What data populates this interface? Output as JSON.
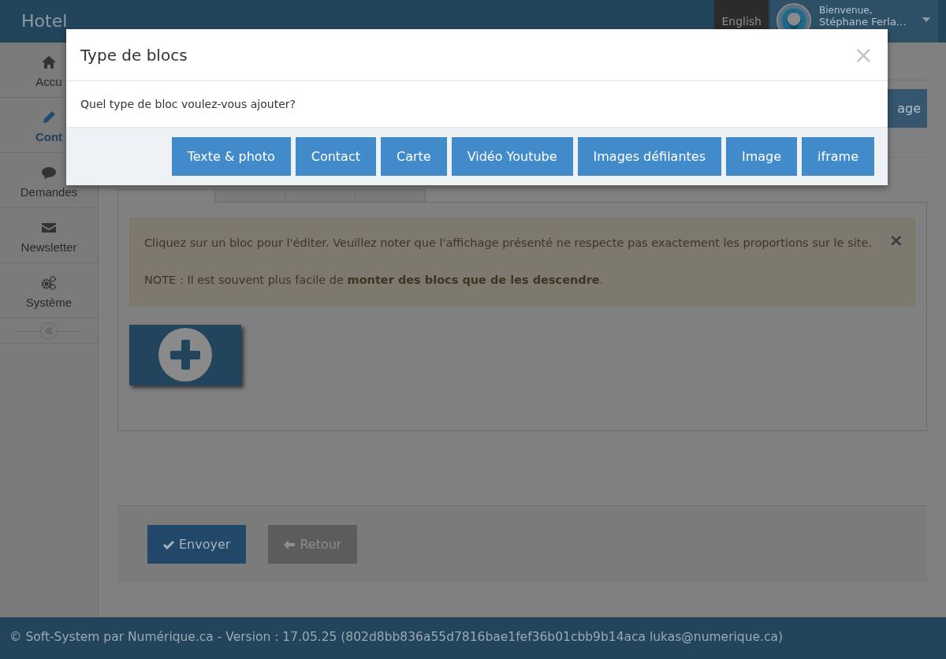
{
  "navbar": {
    "brand": "Hotel",
    "language": "English",
    "user": {
      "greeting": "Bienvenue,",
      "name": "Stéphane Ferla…"
    }
  },
  "sidebar": {
    "items": [
      {
        "label": "Accu",
        "selected": false
      },
      {
        "label": "Cont",
        "selected": true
      },
      {
        "label": "Demandes",
        "selected": false
      },
      {
        "label": "Newsletter",
        "selected": false
      },
      {
        "label": "Système",
        "selected": false
      }
    ]
  },
  "page": {
    "action_button": "age",
    "tabs": [
      {
        "selected": true
      },
      {
        "selected": false
      },
      {
        "selected": false
      },
      {
        "selected": false
      }
    ],
    "alert": {
      "text": "Cliquez sur un bloc pour l'éditer. Veuillez noter que l'affichage présenté ne respecte pas exactement les proportions sur le site.",
      "note": "NOTE : Il est souvent plus facile de **monter des blocs que de les descendre**.",
      "dismiss": "×"
    },
    "form_buttons": [
      {
        "label": "Envoyer",
        "kind": "submit"
      },
      {
        "label": "Retour",
        "kind": "back"
      }
    ]
  },
  "footer": "© Soft-System par Numérique.ca - Version : 17.05.25 (802d8bb836a55d7816bae1fef36b01cbb9b14aca lukas@numerique.ca)",
  "modal": {
    "title": "Type de blocs",
    "close": "×",
    "question": "Quel type de bloc voulez-vous ajouter?",
    "buttons": [
      "Texte & photo",
      "Contact",
      "Carte",
      "Vidéo Youtube",
      "Images défilantes",
      "Image",
      "iframe"
    ]
  }
}
